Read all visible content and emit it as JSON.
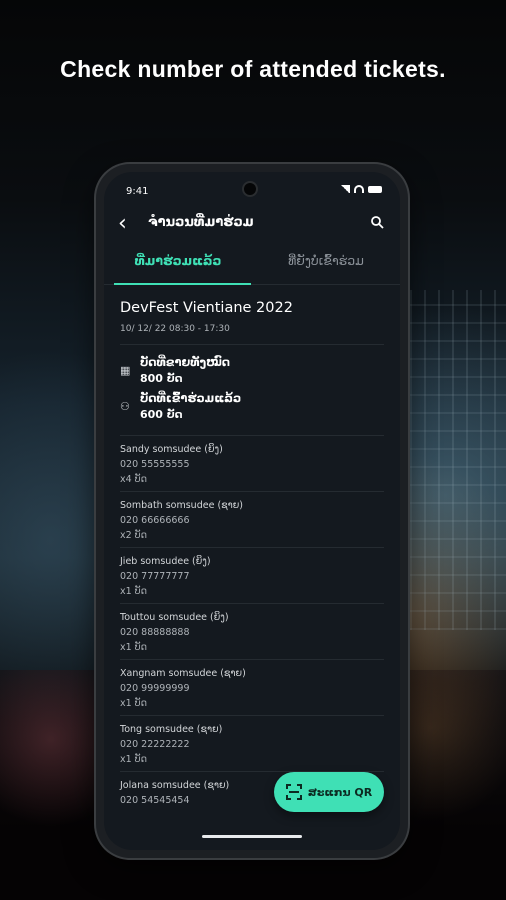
{
  "headline": "Check number of attended tickets.",
  "status_bar": {
    "time": "9:41"
  },
  "app_bar": {
    "title": "ຈຳນວນທີ່ມາຮ່ວມ"
  },
  "tabs": [
    {
      "label": "ທີ່ມາຮ່ວມແລ້ວ",
      "active": true
    },
    {
      "label": "ທີ່ຍັງບໍ່ເຂົ້າຮ່ວມ",
      "active": false
    }
  ],
  "event": {
    "name": "DevFest Vientiane 2022",
    "date": "10/ 12/ 22  08:30 - 17:30"
  },
  "stats": [
    {
      "icon": "ticket-icon",
      "label": "ບັດທີ່ຂາຍທັງໝົດ",
      "value": "800 ບັດ"
    },
    {
      "icon": "person-check-icon",
      "label": "ບັດທີ່ເຂົ້າຮ່ວມແລ້ວ",
      "value": "600 ບັດ"
    }
  ],
  "attendees": [
    {
      "name": "Sandy somsudee (ຍິງ)",
      "phone": "020 55555555",
      "count": "x4 ບັດ"
    },
    {
      "name": "Sombath somsudee (ຊາຍ)",
      "phone": "020 66666666",
      "count": "x2 ບັດ"
    },
    {
      "name": "Jieb somsudee (ຍິງ)",
      "phone": "020 77777777",
      "count": "x1 ບັດ"
    },
    {
      "name": "Touttou somsudee (ຍິງ)",
      "phone": "020 88888888",
      "count": "x1 ບັດ"
    },
    {
      "name": "Xangnam somsudee (ຊາຍ)",
      "phone": "020 99999999",
      "count": "x1 ບັດ"
    },
    {
      "name": "Tong somsudee (ຊາຍ)",
      "phone": "020 22222222",
      "count": "x1 ບັດ"
    },
    {
      "name": "Jolana somsudee (ຊາຍ)",
      "phone": "020 54545454",
      "count": ""
    }
  ],
  "fab": {
    "label": "ສະແກນ QR",
    "icon": "qr-scan-icon"
  },
  "colors": {
    "accent": "#3fe0b5",
    "screen_bg": "#14191f"
  }
}
